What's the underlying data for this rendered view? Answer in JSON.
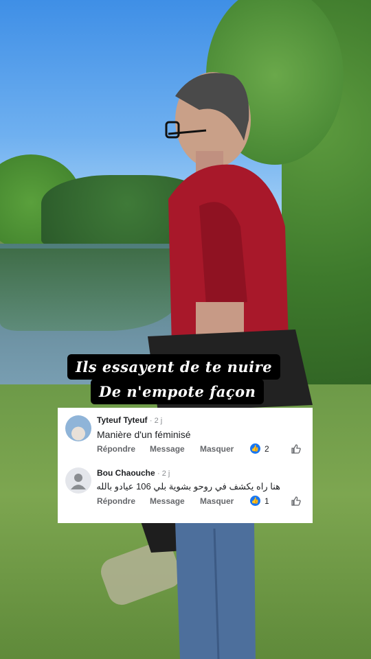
{
  "captions": [
    "Ils essayent de te nuire",
    "De n'empote façon"
  ],
  "comments": [
    {
      "author": "Tyteuf Tyteuf",
      "time": "· 2 j",
      "text": "Manière d'un féminisé",
      "reply": "Répondre",
      "message": "Message",
      "hide": "Masquer",
      "likes": "2"
    },
    {
      "author": "Bou Chaouche",
      "time": "· 2 j",
      "text": "هنا راه يكشف في روحو بشوية بلي 106 عيادو بالله",
      "reply": "Répondre",
      "message": "Message",
      "hide": "Masquer",
      "likes": "1"
    }
  ],
  "icons": {
    "like_badge": "thumbs-up-icon",
    "like_button": "thumbs-up-outline-icon",
    "default_avatar": "person-silhouette-icon"
  },
  "colors": {
    "like_blue": "#1877f2",
    "caption_bg": "#000000",
    "caption_text": "#ffffff"
  }
}
